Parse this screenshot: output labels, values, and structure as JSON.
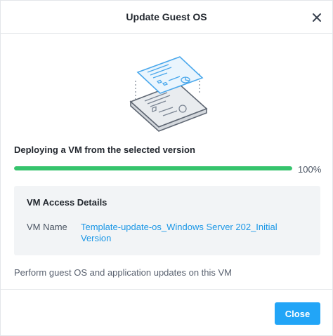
{
  "dialog": {
    "title": "Update Guest OS",
    "close_icon": "close-icon"
  },
  "progress": {
    "label": "Deploying a VM from the selected version",
    "percent_text": "100%",
    "percent": 100,
    "color": "#36c46d"
  },
  "details": {
    "title": "VM Access Details",
    "vm_name_label": "VM Name",
    "vm_name_value": "Template-update-os_Windows Server 202_Initial Version"
  },
  "note": "Perform guest OS and application updates on this VM",
  "footer": {
    "close_label": "Close"
  },
  "colors": {
    "accent": "#22a5f7",
    "link": "#1b97e6",
    "illustration": "#4aa8ec"
  }
}
